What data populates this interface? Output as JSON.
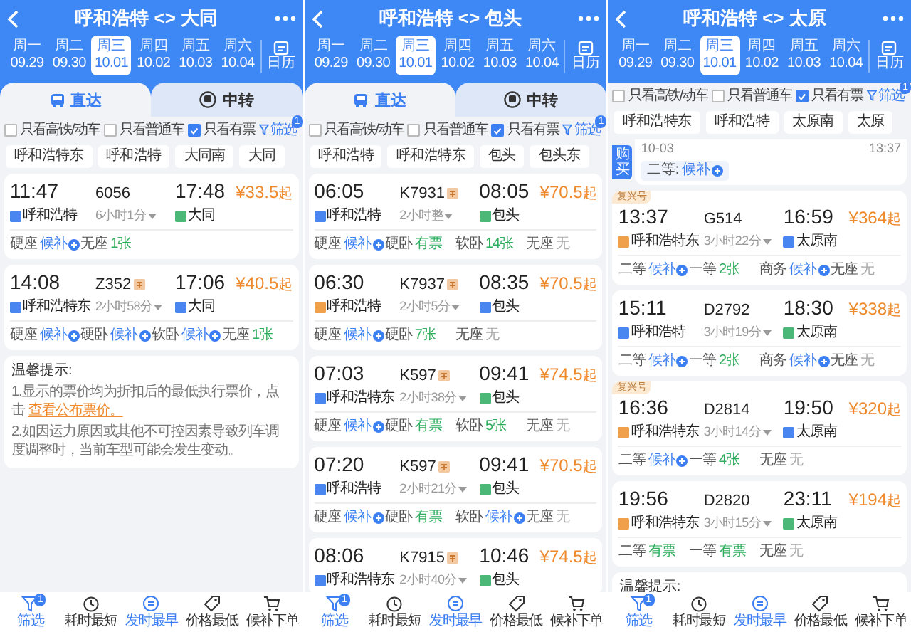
{
  "screens": [
    {
      "title": "呼和浩特 <> 大同",
      "dates": [
        {
          "weekday": "周一",
          "date": "09.29",
          "selected": false
        },
        {
          "weekday": "周二",
          "date": "09.30",
          "selected": false
        },
        {
          "weekday": "周三",
          "date": "10.01",
          "selected": true
        },
        {
          "weekday": "周四",
          "date": "10.02",
          "selected": false
        },
        {
          "weekday": "周五",
          "date": "10.03",
          "selected": false
        },
        {
          "weekday": "周六",
          "date": "10.04",
          "selected": false
        }
      ],
      "calendar": "日历",
      "tabs": [
        {
          "label": "直达",
          "selected": true
        },
        {
          "label": "中转",
          "selected": false
        }
      ],
      "filters": [
        {
          "label": "只看高铁/动车",
          "checked": false
        },
        {
          "label": "只看普通车",
          "checked": false
        },
        {
          "label": "只看有票",
          "checked": true
        }
      ],
      "filter_button": {
        "label": "筛选",
        "badge": "1"
      },
      "stations": [
        "呼和浩特东",
        "呼和浩特",
        "大同南",
        "大同"
      ],
      "trains": [
        {
          "dep": "11:47",
          "no": "6056",
          "tag": false,
          "duration": "6小时1分",
          "arr": "17:48",
          "from": {
            "name": "呼和浩特",
            "color": "#4a86f0"
          },
          "to": {
            "name": "大同",
            "color": "#4cb878"
          },
          "price": "¥33.5",
          "unit": "起",
          "seats": [
            {
              "class": "硬座",
              "status": "候补",
              "kind": "waitlist"
            },
            {
              "class": "无座",
              "status": "1张",
              "kind": "available"
            }
          ]
        },
        {
          "dep": "14:08",
          "no": "Z352",
          "tag": true,
          "duration": "2小时58分",
          "arr": "17:06",
          "from": {
            "name": "呼和浩特东",
            "color": "#4a86f0"
          },
          "to": {
            "name": "大同",
            "color": "#4a86f0"
          },
          "price": "¥40.5",
          "unit": "起",
          "seats": [
            {
              "class": "硬座",
              "status": "候补",
              "kind": "waitlist"
            },
            {
              "class": "硬卧",
              "status": "候补",
              "kind": "waitlist"
            },
            {
              "class": "软卧",
              "status": "候补",
              "kind": "waitlist"
            },
            {
              "class": "无座",
              "status": "1张",
              "kind": "available"
            }
          ]
        }
      ],
      "notice": {
        "title": "温馨提示:",
        "lines": [
          {
            "text": "1.显示的票价均为折扣后的最低执行票价，点击 ",
            "link": "查看公布票价。"
          },
          {
            "text": "2.如因运力原因或其他不可控因素导致列车调度调整时，当前车型可能会发生变动。"
          }
        ]
      },
      "nav": [
        {
          "label": "筛选",
          "active": true,
          "badge": "1"
        },
        {
          "label": "耗时最短",
          "active": false
        },
        {
          "label": "发时最早",
          "active": true
        },
        {
          "label": "价格最低",
          "active": false
        },
        {
          "label": "候补下单",
          "active": false
        }
      ]
    },
    {
      "title": "呼和浩特 <> 包头",
      "dates": [
        {
          "weekday": "周一",
          "date": "09.29",
          "selected": false
        },
        {
          "weekday": "周二",
          "date": "09.30",
          "selected": false
        },
        {
          "weekday": "周三",
          "date": "10.01",
          "selected": true
        },
        {
          "weekday": "周四",
          "date": "10.02",
          "selected": false
        },
        {
          "weekday": "周五",
          "date": "10.03",
          "selected": false
        },
        {
          "weekday": "周六",
          "date": "10.04",
          "selected": false
        }
      ],
      "calendar": "日历",
      "tabs": [
        {
          "label": "直达",
          "selected": true
        },
        {
          "label": "中转",
          "selected": false
        }
      ],
      "filters": [
        {
          "label": "只看高铁/动车",
          "checked": false
        },
        {
          "label": "只看普通车",
          "checked": false
        },
        {
          "label": "只看有票",
          "checked": true
        }
      ],
      "filter_button": {
        "label": "筛选",
        "badge": "1"
      },
      "stations": [
        "呼和浩特",
        "呼和浩特东",
        "包头",
        "包头东"
      ],
      "trains": [
        {
          "dep": "06:05",
          "no": "K7931",
          "tag": true,
          "duration": "2小时整",
          "arr": "08:05",
          "from": {
            "name": "呼和浩特",
            "color": "#4a86f0"
          },
          "to": {
            "name": "包头",
            "color": "#4cb878"
          },
          "price": "¥70.5",
          "unit": "起",
          "seats": [
            {
              "class": "硬座",
              "status": "候补",
              "kind": "waitlist"
            },
            {
              "class": "硬卧",
              "status": "有票",
              "kind": "available"
            },
            {
              "class": "软卧",
              "status": "14张",
              "kind": "available"
            },
            {
              "class": "无座",
              "status": "无",
              "kind": "none"
            }
          ]
        },
        {
          "dep": "06:30",
          "no": "K7937",
          "tag": true,
          "duration": "2小时5分",
          "arr": "08:35",
          "from": {
            "name": "呼和浩特",
            "color": "#f0a04b"
          },
          "to": {
            "name": "包头",
            "color": "#4a86f0"
          },
          "price": "¥70.5",
          "unit": "起",
          "seats": [
            {
              "class": "硬座",
              "status": "候补",
              "kind": "waitlist"
            },
            {
              "class": "硬卧",
              "status": "7张",
              "kind": "available"
            },
            {
              "class": "无座",
              "status": "无",
              "kind": "none"
            }
          ]
        },
        {
          "dep": "07:03",
          "no": "K597",
          "tag": true,
          "duration": "2小时38分",
          "arr": "09:41",
          "from": {
            "name": "呼和浩特东",
            "color": "#4a86f0"
          },
          "to": {
            "name": "包头",
            "color": "#4cb878"
          },
          "price": "¥74.5",
          "unit": "起",
          "seats": [
            {
              "class": "硬座",
              "status": "候补",
              "kind": "waitlist"
            },
            {
              "class": "硬卧",
              "status": "有票",
              "kind": "available"
            },
            {
              "class": "软卧",
              "status": "5张",
              "kind": "available"
            },
            {
              "class": "无座",
              "status": "无",
              "kind": "none"
            }
          ]
        },
        {
          "dep": "07:20",
          "no": "K597",
          "tag": true,
          "duration": "2小时21分",
          "arr": "09:41",
          "from": {
            "name": "呼和浩特",
            "color": "#4a86f0"
          },
          "to": {
            "name": "包头",
            "color": "#4cb878"
          },
          "price": "¥70.5",
          "unit": "起",
          "seats": [
            {
              "class": "硬座",
              "status": "候补",
              "kind": "waitlist"
            },
            {
              "class": "硬卧",
              "status": "有票",
              "kind": "available"
            },
            {
              "class": "软卧",
              "status": "候补",
              "kind": "waitlist"
            },
            {
              "class": "无座",
              "status": "无",
              "kind": "none"
            }
          ]
        },
        {
          "dep": "08:06",
          "no": "K7915",
          "tag": true,
          "duration": "2小时40分",
          "arr": "10:46",
          "from": {
            "name": "呼和浩特东",
            "color": "#4a86f0"
          },
          "to": {
            "name": "包头",
            "color": "#4cb878"
          },
          "price": "¥74.5",
          "unit": "起"
        }
      ],
      "nav": [
        {
          "label": "筛选",
          "active": true,
          "badge": "1"
        },
        {
          "label": "耗时最短",
          "active": false
        },
        {
          "label": "发时最早",
          "active": true
        },
        {
          "label": "价格最低",
          "active": false
        },
        {
          "label": "候补下单",
          "active": false
        }
      ]
    },
    {
      "title": "呼和浩特 <> 太原",
      "dates": [
        {
          "weekday": "周一",
          "date": "09.29",
          "selected": false
        },
        {
          "weekday": "周二",
          "date": "09.30",
          "selected": false
        },
        {
          "weekday": "周三",
          "date": "10.01",
          "selected": true
        },
        {
          "weekday": "周四",
          "date": "10.02",
          "selected": false
        },
        {
          "weekday": "周五",
          "date": "10.03",
          "selected": false
        },
        {
          "weekday": "周六",
          "date": "10.04",
          "selected": false
        }
      ],
      "calendar": "日历",
      "filters": [
        {
          "label": "只看高铁/动车",
          "checked": false
        },
        {
          "label": "只看普通车",
          "checked": false
        },
        {
          "label": "只看有票",
          "checked": true
        }
      ],
      "filter_button": {
        "label": "筛选",
        "badge": "1"
      },
      "stations": [
        "呼和浩特东",
        "呼和浩特",
        "太原南",
        "太原"
      ],
      "partial": {
        "side_tag": "购买",
        "date": "10-03",
        "time": "13:37",
        "seat_class": "二等:",
        "seat_status": "候补"
      },
      "trains": [
        {
          "label": "复兴号",
          "dep": "13:37",
          "no": "G514",
          "tag": false,
          "duration": "3小时22分",
          "arr": "16:59",
          "from": {
            "name": "呼和浩特东",
            "color": "#f0a04b"
          },
          "to": {
            "name": "太原南",
            "color": "#4a86f0"
          },
          "price": "¥364",
          "unit": "起",
          "seats": [
            {
              "class": "二等",
              "status": "候补",
              "kind": "waitlist"
            },
            {
              "class": "一等",
              "status": "2张",
              "kind": "available"
            },
            {
              "class": "商务",
              "status": "候补",
              "kind": "waitlist"
            },
            {
              "class": "无座",
              "status": "无",
              "kind": "none"
            }
          ]
        },
        {
          "dep": "15:11",
          "no": "D2792",
          "tag": false,
          "duration": "3小时19分",
          "arr": "18:30",
          "from": {
            "name": "呼和浩特",
            "color": "#4a86f0"
          },
          "to": {
            "name": "太原南",
            "color": "#4cb878"
          },
          "price": "¥338",
          "unit": "起",
          "seats": [
            {
              "class": "二等",
              "status": "候补",
              "kind": "waitlist"
            },
            {
              "class": "一等",
              "status": "2张",
              "kind": "available"
            },
            {
              "class": "商务",
              "status": "候补",
              "kind": "waitlist"
            },
            {
              "class": "无座",
              "status": "无",
              "kind": "none"
            }
          ]
        },
        {
          "label": "复兴号",
          "dep": "16:36",
          "no": "D2814",
          "tag": false,
          "duration": "3小时14分",
          "arr": "19:50",
          "from": {
            "name": "呼和浩特东",
            "color": "#f0a04b"
          },
          "to": {
            "name": "太原南",
            "color": "#4a86f0"
          },
          "price": "¥320",
          "unit": "起",
          "seats": [
            {
              "class": "二等",
              "status": "候补",
              "kind": "waitlist"
            },
            {
              "class": "一等",
              "status": "4张",
              "kind": "available"
            },
            {
              "class": "无座",
              "status": "无",
              "kind": "none"
            }
          ]
        },
        {
          "dep": "19:56",
          "no": "D2820",
          "tag": false,
          "duration": "3小时15分",
          "arr": "23:11",
          "from": {
            "name": "呼和浩特东",
            "color": "#f0a04b"
          },
          "to": {
            "name": "太原南",
            "color": "#4cb878"
          },
          "price": "¥194",
          "unit": "起",
          "seats": [
            {
              "class": "二等",
              "status": "有票",
              "kind": "available"
            },
            {
              "class": "一等",
              "status": "有票",
              "kind": "available"
            },
            {
              "class": "无座",
              "status": "无",
              "kind": "none"
            }
          ]
        }
      ],
      "notice": {
        "title": "温馨提示:"
      },
      "nav": [
        {
          "label": "筛选",
          "active": true,
          "badge": "1"
        },
        {
          "label": "耗时最短",
          "active": false
        },
        {
          "label": "发时最早",
          "active": true
        },
        {
          "label": "价格最低",
          "active": false
        },
        {
          "label": "候补下单",
          "active": false
        }
      ]
    }
  ]
}
